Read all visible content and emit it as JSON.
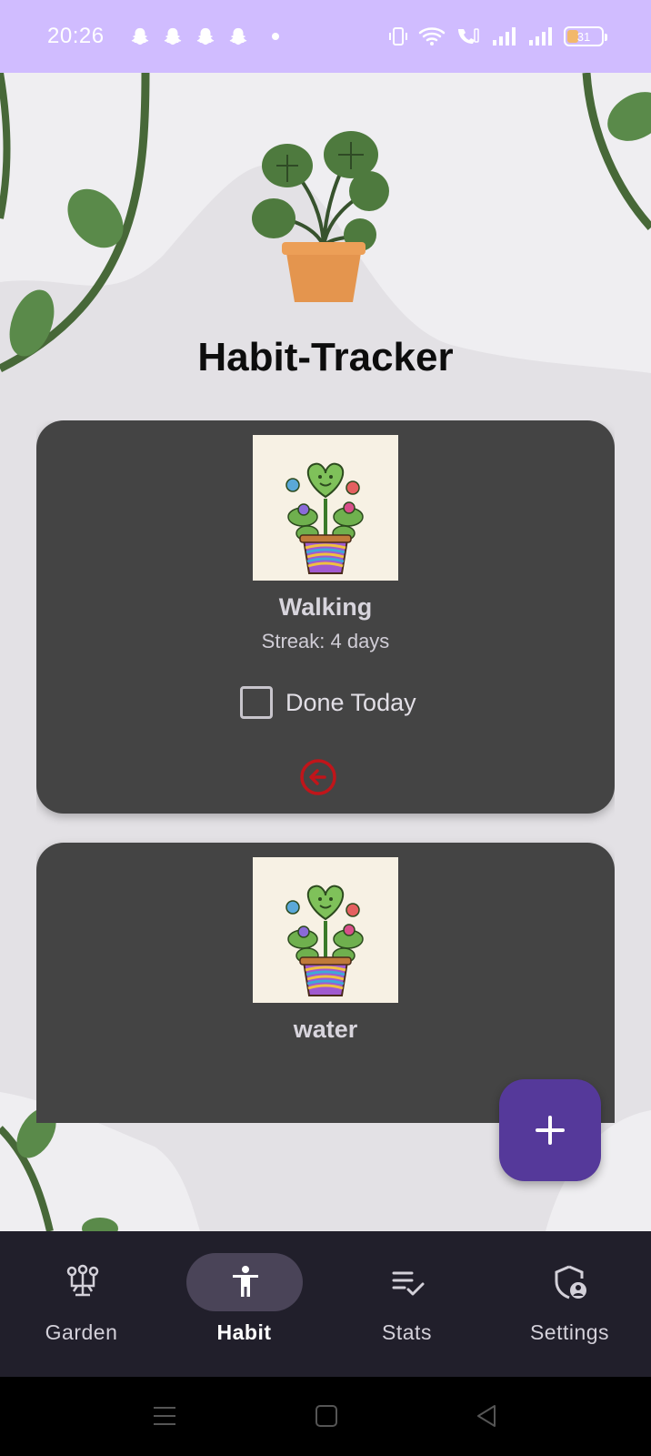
{
  "status_bar": {
    "time": "20:26",
    "battery_level": "31",
    "notification_icons": [
      "snapchat-icon",
      "snapchat-icon",
      "snapchat-icon",
      "snapchat-icon"
    ],
    "status_icons": [
      "vibrate-icon",
      "wifi-icon",
      "wifi-call-icon",
      "signal-icon",
      "signal-icon",
      "battery-icon"
    ]
  },
  "header": {
    "title": "Habit-Tracker"
  },
  "habits": [
    {
      "name": "Walking",
      "streak": "Streak: 4 days",
      "done_label": "Done Today",
      "done": false
    },
    {
      "name": "water"
    }
  ],
  "fab": {
    "icon": "plus-icon"
  },
  "bottom_nav": {
    "items": [
      {
        "label": "Garden",
        "icon": "garden-icon",
        "active": false
      },
      {
        "label": "Habit",
        "icon": "person-icon",
        "active": true
      },
      {
        "label": "Stats",
        "icon": "checklist-icon",
        "active": false
      },
      {
        "label": "Settings",
        "icon": "shield-user-icon",
        "active": false
      }
    ]
  },
  "colors": {
    "status_bar": "#d0bcff",
    "card": "#444444",
    "fab": "#55399a",
    "nav_bar": "#211f2b",
    "delete": "#c0151a"
  }
}
